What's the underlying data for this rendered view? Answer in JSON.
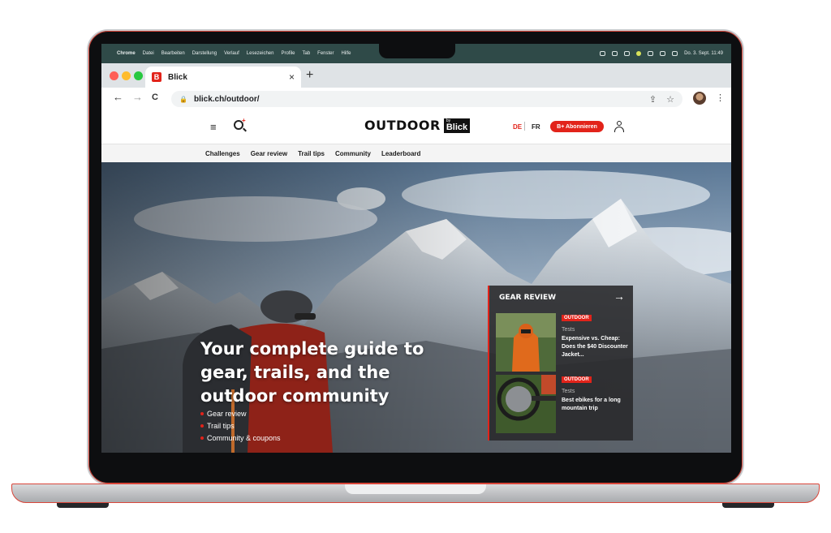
{
  "macos_menubar": {
    "apple": "",
    "app": "Chrome",
    "menus": [
      "Datei",
      "Bearbeiten",
      "Darstellung",
      "Verlauf",
      "Lesezeichen",
      "Profile",
      "Tab",
      "Fenster",
      "Hilfe"
    ],
    "datetime": "Do. 3. Sept. 11:49"
  },
  "browser": {
    "tab_title": "Blick",
    "tab_favicon": "B",
    "close_glyph": "×",
    "new_tab_glyph": "+",
    "back_glyph": "←",
    "forward_glyph": "→",
    "reload_glyph": "C",
    "url": "blick.ch/outdoor/",
    "share_glyph": "⇪",
    "bookmark_glyph": "☆",
    "menu_glyph": "⋮"
  },
  "site_header": {
    "menu_glyph": "≡",
    "search_plus": "+",
    "logo_text": "OUTDOOR",
    "logo_by": "by",
    "logo_brand": "Blick",
    "lang_de": "DE",
    "lang_fr": "FR",
    "subscribe": "B+ Abonnieren"
  },
  "subnav": {
    "items": [
      "Challenges",
      "Gear review",
      "Trail tips",
      "Community",
      "Leaderboard"
    ]
  },
  "hero": {
    "title": "Your complete guide to gear, trails, and the outdoor community",
    "bullets": [
      "Gear review",
      "Trail tips",
      "Community & coupons"
    ]
  },
  "gear_review": {
    "heading": "GEAR REVIEW",
    "arrow_glyph": "→",
    "items": [
      {
        "badge": "OUTDOOR",
        "category": "Tests",
        "title": "Expensive vs. Cheap: Does the $40 Discounter Jacket..."
      },
      {
        "badge": "OUTDOOR",
        "category": "Tests",
        "title": "Best ebikes for a long mountain trip"
      }
    ]
  },
  "colors": {
    "brand_red": "#e2231a",
    "menubar": "#2f4a48"
  }
}
